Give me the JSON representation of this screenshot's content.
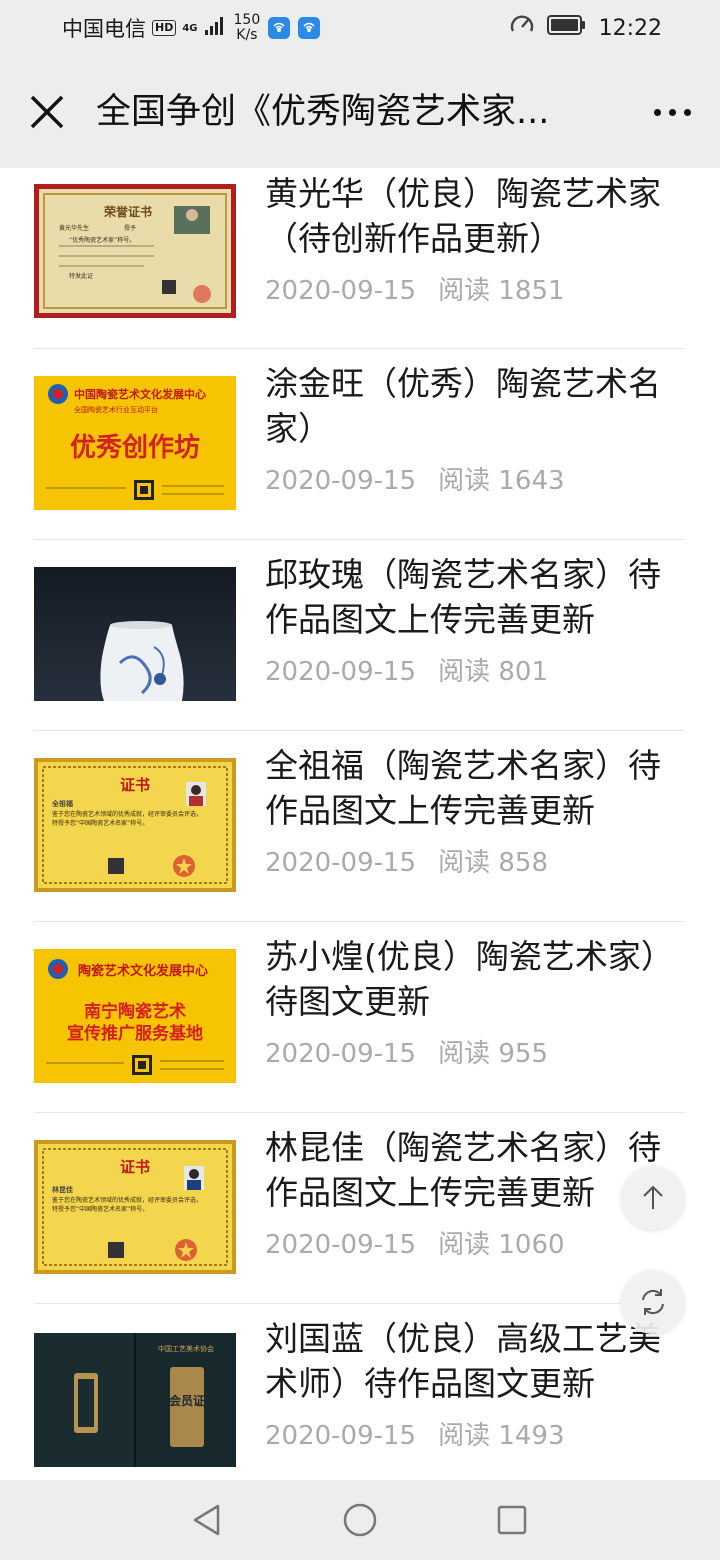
{
  "status_bar": {
    "carrier": "中国电信",
    "hd": "HD",
    "network": "4G",
    "speed_value": "150",
    "speed_unit": "K/s",
    "time": "12:22"
  },
  "header": {
    "title": "全国争创《优秀陶瓷艺术家..."
  },
  "articles": [
    {
      "title": "黄光华（优良）陶瓷艺术家（待创新作品更新）",
      "date": "2020-09-15",
      "views": "阅读 1851",
      "thumb": "honor-certificate"
    },
    {
      "title": "涂金旺（优秀）陶瓷艺术名家）",
      "date": "2020-09-15",
      "views": "阅读 1643",
      "thumb": "yellow-plaque-workshop"
    },
    {
      "title": "邱玫瑰（陶瓷艺术名家）待作品图文上传完善更新",
      "date": "2020-09-15",
      "views": "阅读 801",
      "thumb": "porcelain-vase"
    },
    {
      "title": "全祖福（陶瓷艺术名家）待作品图文上传完善更新",
      "date": "2020-09-15",
      "views": "阅读 858",
      "thumb": "certificate"
    },
    {
      "title": "苏小煌(优良）陶瓷艺术家）待图文更新",
      "date": "2020-09-15",
      "views": "阅读 955",
      "thumb": "yellow-plaque-base"
    },
    {
      "title": "林昆佳（陶瓷艺术名家）待作品图文上传完善更新",
      "date": "2020-09-15",
      "views": "阅读 1060",
      "thumb": "certificate"
    },
    {
      "title": "刘国蓝（优良）高级工艺美术师）待作品图文更新",
      "date": "2020-09-15",
      "views": "阅读 1493",
      "thumb": "dark-booklet"
    }
  ],
  "thumb_text": {
    "honor": {
      "title": "荣誉证书",
      "line1": "黄光华先生",
      "line2": "授予",
      "line3": "“优秀陶瓷艺术家”称号。",
      "line4": "特发此证"
    },
    "workshop": {
      "header": "中国陶瓷艺术文化发展中心",
      "sub": "全国陶瓷艺术行业互动平台",
      "main": "优秀创作坊"
    },
    "cert1": {
      "title": "证书",
      "name": "全祖福",
      "body": "鉴于您在陶瓷艺术领域的优秀成就，经评审委员会评选，特授予您“中国陶瓷艺术名家”称号。"
    },
    "base": {
      "header": "陶瓷艺术文化发展中心",
      "main1": "南宁陶瓷艺术",
      "main2": "宣传推广服务基地"
    },
    "cert2": {
      "title": "证书",
      "name": "林昆佳",
      "body": "鉴于您在陶瓷艺术领域的优秀成就，经评审委员会评选，特授予您“中国陶瓷艺术名家”称号。"
    },
    "booklet": {
      "title": "中国工艺美术协会",
      "cover": "会员证"
    }
  },
  "colors": {
    "bar_bg": "#ededed",
    "meta_gray": "#aaaaaa",
    "plaque_yellow": "#f6c400",
    "plaque_red": "#d42020",
    "wifi_blue": "#2b8ae6"
  }
}
